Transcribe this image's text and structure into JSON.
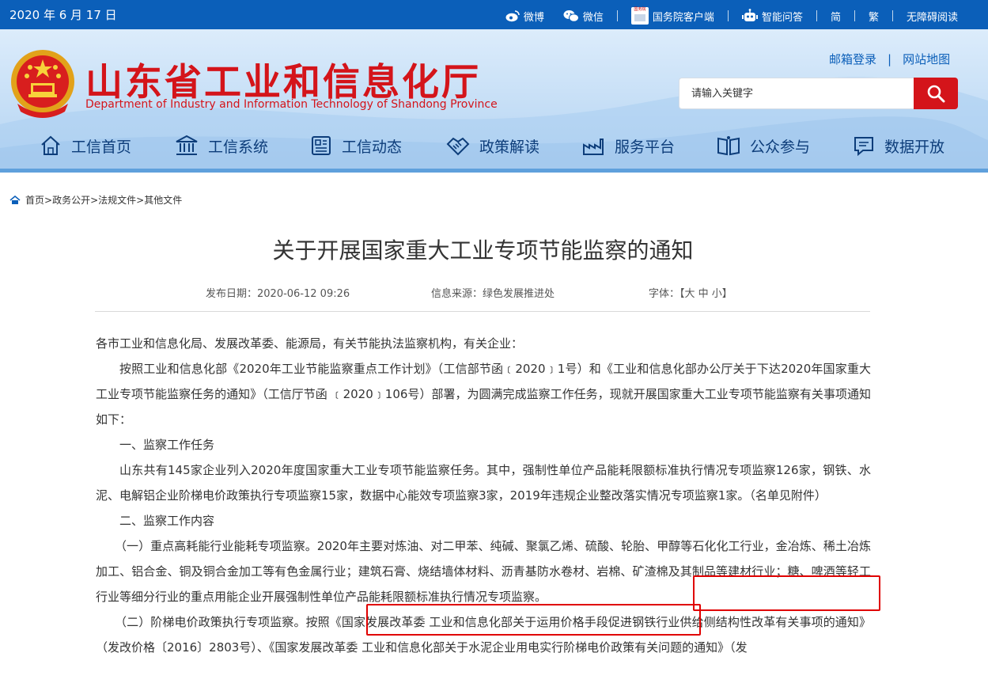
{
  "topbar": {
    "date": "2020 年 6 月 17 日",
    "links": {
      "weibo": "微博",
      "wechat": "微信",
      "gov_client": "国务院客户端",
      "gov_client_badge": "国务院",
      "smart_qa": "智能问答",
      "simplified": "简",
      "traditional": "繁",
      "accessible": "无障碍阅读"
    }
  },
  "header": {
    "title": "山东省工业和信息化厅",
    "subtitle": "Department of Industry and Information Technology of Shandong Province",
    "mail_login": "邮箱登录",
    "sitemap": "网站地图",
    "search": {
      "placeholder": "请输入关键字"
    }
  },
  "nav": {
    "items": [
      "工信首页",
      "工信系统",
      "工信动态",
      "政策解读",
      "服务平台",
      "公众参与",
      "数据开放"
    ]
  },
  "breadcrumb": [
    "首页",
    "政务公开",
    "法规文件",
    "其他文件"
  ],
  "article": {
    "title": "关于开展国家重大工业专项节能监察的通知",
    "publish_date": "发布日期：2020-06-12 09:26",
    "source": "信息来源：绿色发展推进处",
    "font_size": "字体：【大 中 小】",
    "paragraphs": [
      "各市工业和信息化局、发展改革委、能源局，有关节能执法监察机构，有关企业：",
      "按照工业和信息化部《2020年工业节能监察重点工作计划》（工信部节函﹝2020﹞1号）和《工业和信息化部办公厅关于下达2020年国家重大工业专项节能监察任务的通知》（工信厅节函 ﹝2020﹞106号）部署，为圆满完成监察工作任务，现就开展国家重大工业专项节能监察有关事项通知如下：",
      "一、监察工作任务",
      "山东共有145家企业列入2020年度国家重大工业专项节能监察任务。其中，强制性单位产品能耗限额标准执行情况专项监察126家，钢铁、水泥、电解铝企业阶梯电价政策执行专项监察15家，数据中心能效专项监察3家，2019年违规企业整改落实情况专项监察1家。（名单见附件）",
      "二、监察工作内容",
      "（一）重点高耗能行业能耗专项监察。2020年主要对炼油、对二甲苯、纯碱、聚氯乙烯、硫酸、轮胎、甲醇等石化化工行业，金冶炼、稀土冶炼加工、铝合金、铜及铜合金加工等有色金属行业；建筑石膏、烧结墙体材料、沥青基防水卷材、岩棉、矿渣棉及其制品等建材行业；糖、啤酒等轻工行业等细分行业的重点用能企业开展强制性单位产品能耗限额标准执行情况专项监察。",
      "（二）阶梯电价政策执行专项监察。按照《国家发展改革委 工业和信息化部关于运用价格手段促进钢铁行业供给侧结构性改革有关事项的通知》（发改价格〔2016〕2803号）、《国家发展改革委 工业和信息化部关于水泥企业用电实行阶梯电价政策有关问题的通知》（发"
    ]
  }
}
